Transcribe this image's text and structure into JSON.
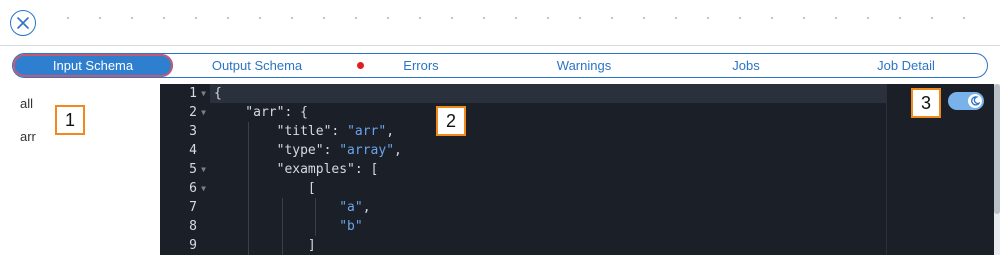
{
  "header": {
    "close_icon": "close-x-icon"
  },
  "tabs": [
    {
      "label": "Input Schema",
      "active": true
    },
    {
      "label": "Output Schema",
      "active": false
    },
    {
      "label": "Errors",
      "active": false,
      "indicator": "red-dot"
    },
    {
      "label": "Warnings",
      "active": false
    },
    {
      "label": "Jobs",
      "active": false
    },
    {
      "label": "Job Detail",
      "active": false
    }
  ],
  "sidebar": {
    "items": [
      {
        "label": "all"
      },
      {
        "label": "arr"
      }
    ]
  },
  "callouts": [
    "1",
    "2",
    "3"
  ],
  "editor": {
    "line_numbers": [
      "1",
      "2",
      "3",
      "4",
      "5",
      "6",
      "7",
      "8",
      "9"
    ],
    "lines": [
      "{",
      "    \"arr\": {",
      "        \"title\": ",
      "        \"type\": ",
      "        \"examples\": [",
      "            [",
      "                ",
      "                ",
      "            ]"
    ],
    "strings": {
      "l3": "\"arr\"",
      "l3_tail": ",",
      "l4": "\"array\"",
      "l4_tail": ",",
      "l7": "\"a\"",
      "l7_tail": ",",
      "l8": "\"b\""
    },
    "theme_toggle": "moon-icon"
  },
  "colors": {
    "accent": "#2b74c7",
    "callout_border": "#f08a1c",
    "error_dot": "#e02020",
    "editor_bg": "#1b1f28",
    "string": "#6ba4ea"
  }
}
